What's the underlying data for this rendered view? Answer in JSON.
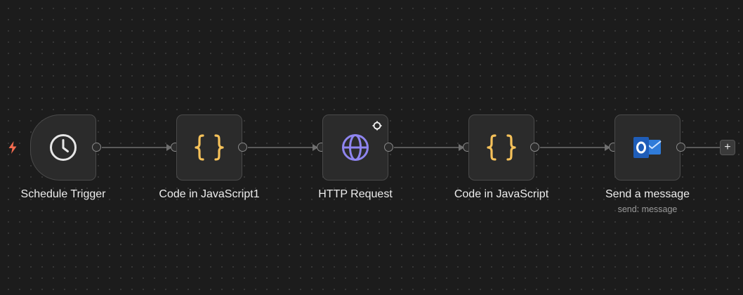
{
  "workflow": {
    "nodes": [
      {
        "id": "schedule",
        "label": "Schedule Trigger",
        "icon": "clock-icon"
      },
      {
        "id": "code1",
        "label": "Code in JavaScript1",
        "icon": "braces-icon"
      },
      {
        "id": "http",
        "label": "HTTP Request",
        "icon": "globe-icon"
      },
      {
        "id": "code2",
        "label": "Code in JavaScript",
        "icon": "braces-icon"
      },
      {
        "id": "outlook",
        "label": "Send a message",
        "sublabel": "send: message",
        "icon": "outlook-icon"
      }
    ],
    "add_node_label": "+"
  },
  "colors": {
    "canvas_bg": "#1c1c1c",
    "node_bg": "#2b2b2b",
    "node_border": "#4a4a4a",
    "connector": "#6f6f6f",
    "trigger_bolt": "#f26b4f",
    "code_icon": "#f5c15a",
    "http_icon": "#8f85f0",
    "outlook_blue": "#1f5db8"
  }
}
